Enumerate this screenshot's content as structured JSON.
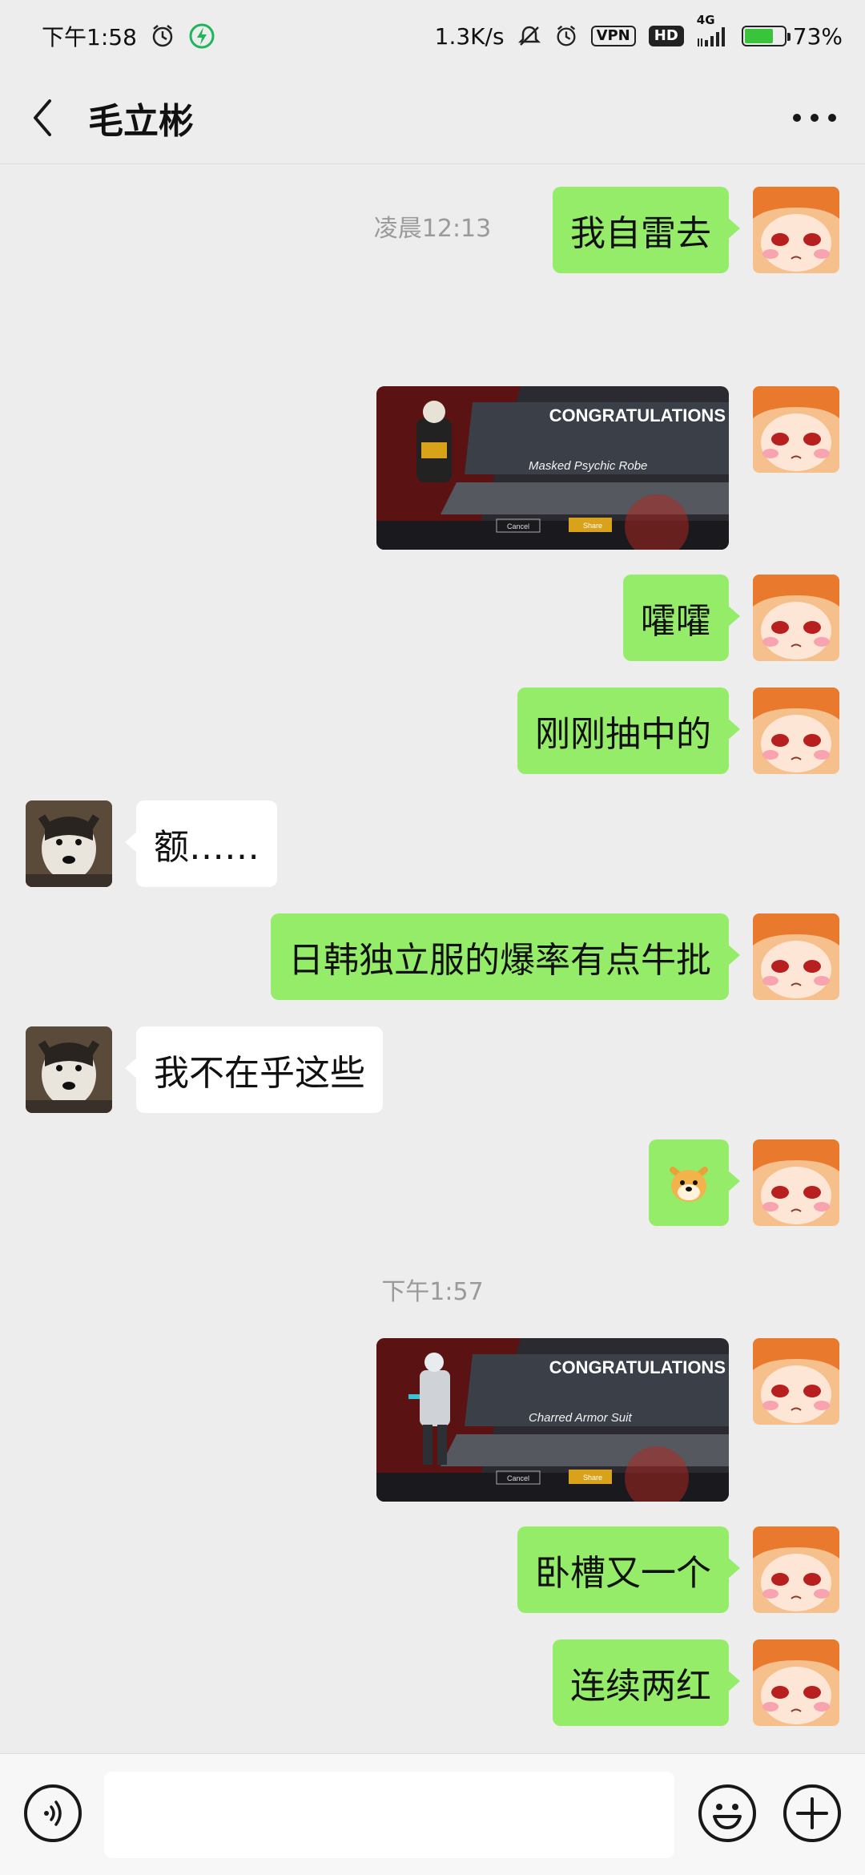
{
  "status_bar": {
    "time": "下午1:58",
    "net_speed": "1.3K/s",
    "vpn": "VPN",
    "hd": "HD",
    "network": "4G",
    "battery": "73%",
    "battery_level": 0.73
  },
  "header": {
    "title": "毛立彬"
  },
  "messages": {
    "m1": "我自雷去",
    "ts1": "凌晨12:13",
    "img1": {
      "heading": "CONGRATULATIONS",
      "item": "Masked Psychic Robe",
      "cancel": "Cancel",
      "share": "Share"
    },
    "m2": "嚯嚯",
    "m3": "刚刚抽中的",
    "m4": "额……",
    "m5": "日韩独立服的爆率有点牛批",
    "m6": "我不在乎这些",
    "m7_emoji": "🐶",
    "ts2": "下午1:57",
    "img2": {
      "heading": "CONGRATULATIONS",
      "item": "Charred Armor Suit",
      "cancel": "Cancel",
      "share": "Share"
    },
    "m8": "卧槽又一个",
    "m9": "连续两红"
  },
  "input": {
    "value": "",
    "placeholder": ""
  },
  "colors": {
    "bg": "#ededed",
    "self_bubble": "#95ec69",
    "peer_bubble": "#ffffff",
    "battery_green": "#39c43b",
    "charging_icon": "#1fb55a"
  },
  "icons": [
    "back-arrow-icon",
    "more-icon",
    "alarm-icon",
    "charging-icon",
    "mute-icon",
    "signal-icon",
    "voice-icon",
    "emoji-icon",
    "plus-icon"
  ]
}
